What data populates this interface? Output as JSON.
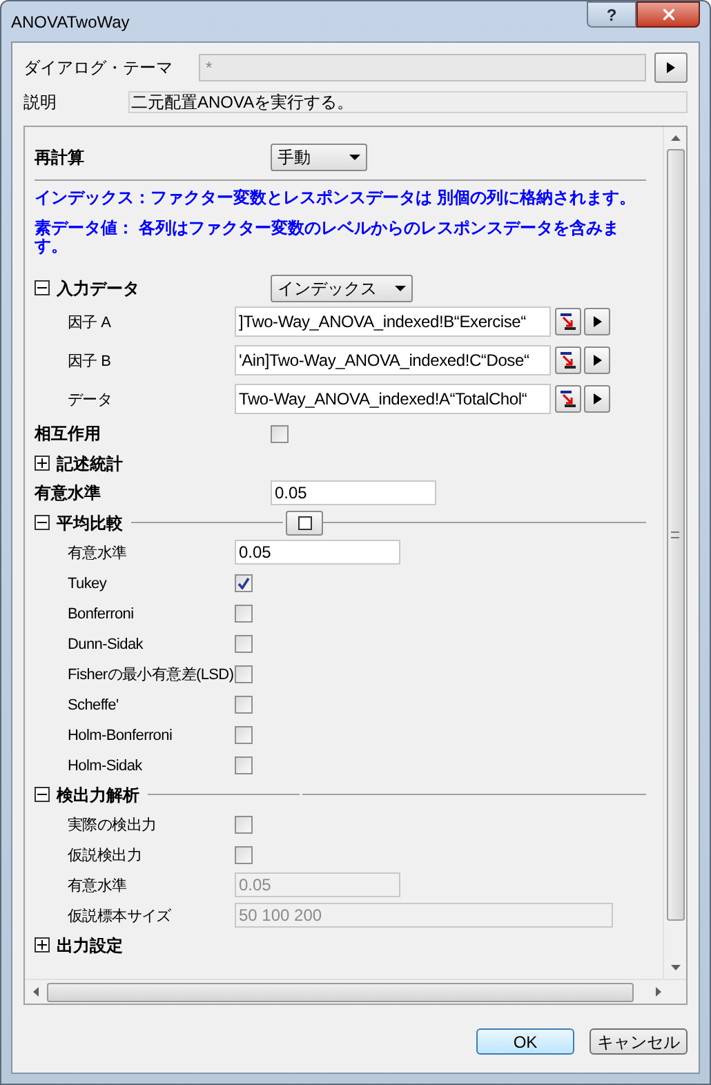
{
  "window": {
    "title": "ANOVATwoWay",
    "help_button": "?"
  },
  "theme": {
    "label": "ダイアログ・テーマ",
    "value": "*"
  },
  "description": {
    "label": "説明",
    "value": "二元配置ANOVAを実行する。"
  },
  "recalculate": {
    "label": "再計算",
    "value": "手動"
  },
  "notes": [
    "インデックス：ファクター変数とレスポンスデータは 別個の列に格納されます。",
    "素データ値： 各列はファクター変数のレベルからのレスポンスデータを含みます。"
  ],
  "rows": [
    {
      "kind": "section",
      "label": "入力データ",
      "expanded": true,
      "dropdown": "インデックス",
      "children": [
        {
          "kind": "range",
          "label": "因子 A",
          "value": "]Two-Way_ANOVA_indexed!B“Exercise“"
        },
        {
          "kind": "range",
          "label": "因子 B",
          "value": "'Ain]Two-Way_ANOVA_indexed!C“Dose“"
        },
        {
          "kind": "range",
          "label": "データ",
          "value": "Two-Way_ANOVA_indexed!A“TotalChol“"
        }
      ]
    },
    {
      "kind": "checkbox",
      "label": "相互作用",
      "checked": false
    },
    {
      "kind": "section",
      "label": "記述統計",
      "expanded": false
    },
    {
      "kind": "number",
      "label": "有意水準",
      "value": "0.05",
      "disabled": false
    },
    {
      "kind": "section",
      "label": "平均比較",
      "expanded": true,
      "toggle_button": true,
      "children": [
        {
          "kind": "number",
          "label": "有意水準",
          "value": "0.05",
          "disabled": false
        },
        {
          "kind": "checkbox",
          "label": "Tukey",
          "checked": true
        },
        {
          "kind": "checkbox",
          "label": "Bonferroni",
          "checked": false
        },
        {
          "kind": "checkbox",
          "label": "Dunn-Sidak",
          "checked": false
        },
        {
          "kind": "checkbox",
          "label": "Fisherの最小有意差(LSD)",
          "checked": false
        },
        {
          "kind": "checkbox",
          "label": "Scheffe'",
          "checked": false
        },
        {
          "kind": "checkbox",
          "label": "Holm-Bonferroni",
          "checked": false
        },
        {
          "kind": "checkbox",
          "label": "Holm-Sidak",
          "checked": false
        }
      ]
    },
    {
      "kind": "section",
      "label": "検出力解析",
      "expanded": true,
      "children": [
        {
          "kind": "checkbox",
          "label": "実際の検出力",
          "checked": false
        },
        {
          "kind": "checkbox",
          "label": "仮説検出力",
          "checked": false
        },
        {
          "kind": "number",
          "label": "有意水準",
          "value": "0.05",
          "disabled": true
        },
        {
          "kind": "text",
          "label": "仮説標本サイズ",
          "value": "50 100 200",
          "disabled": true
        }
      ]
    },
    {
      "kind": "section",
      "label": "出力設定",
      "expanded": false
    }
  ],
  "buttons": [
    {
      "label": "OK",
      "default": true
    },
    {
      "label": "キャンセル",
      "default": false
    }
  ]
}
